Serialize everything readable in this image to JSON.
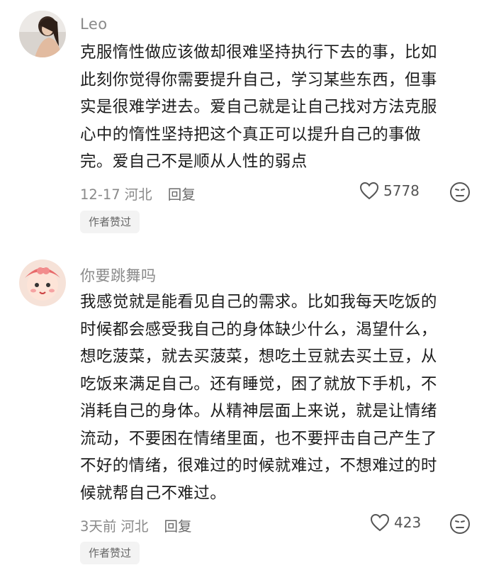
{
  "comments": [
    {
      "username": "Leo",
      "text_lines": [
        "克服惰性做应该做却很难坚持执行下去的事，比如",
        "此刻你觉得你需要提升自己，学习某些东西，但事",
        "实是很难学进去。爱自己就是让自己找对方法克服",
        "心中的惰性坚持把这个真正可以提升自己的事做",
        "完。爱自己不是顺从人性的弱点"
      ],
      "date": "12-17",
      "location": "河北",
      "reply_label": "回复",
      "likes": "5778",
      "badge": "作者赞过",
      "like_icon": "heart-outline-icon",
      "dislike_icon": "meh-face-icon"
    },
    {
      "username": "你要跳舞吗",
      "text_lines": [
        "我感觉就是能看见自己的需求。比如我每天吃饭的",
        "时候都会感受我自己的身体缺少什么，渴望什么，",
        "想吃菠菜，就去买菠菜，想吃土豆就去买土豆，从",
        "吃饭来满足自己。还有睡觉，困了就放下手机，不",
        "消耗自己的身体。从精神层面上来说，就是让情绪",
        "流动，不要困在情绪里面，也不要抨击自己产生了",
        "不好的情绪，很难过的时候就难过，不想难过的时",
        "候就帮自己不难过。"
      ],
      "date": "3天前",
      "location": "河北",
      "reply_label": "回复",
      "likes": "423",
      "badge": "作者赞过",
      "like_icon": "heart-outline-icon",
      "dislike_icon": "meh-face-icon"
    }
  ],
  "colors": {
    "text": "#1c1c1c",
    "secondary": "#8a8a8a",
    "badge_bg": "#f3f3f3"
  }
}
